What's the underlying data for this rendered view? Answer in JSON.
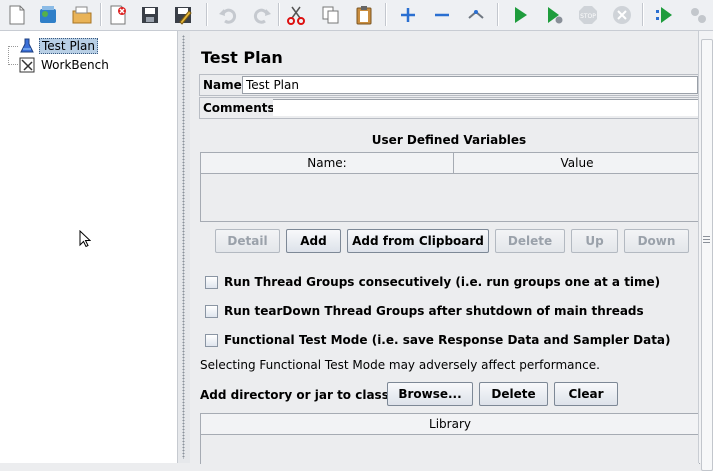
{
  "toolbar": {
    "buttons": [
      {
        "name": "new-icon",
        "enabled": true
      },
      {
        "name": "templates-icon",
        "enabled": true
      },
      {
        "name": "open-icon",
        "enabled": true
      },
      {
        "name": "close-icon",
        "enabled": true
      },
      {
        "name": "save-icon",
        "enabled": true
      },
      {
        "name": "save-as-icon",
        "enabled": true
      },
      {
        "name": "undo-icon",
        "enabled": false
      },
      {
        "name": "redo-icon",
        "enabled": false
      },
      {
        "name": "cut-icon",
        "enabled": true
      },
      {
        "name": "copy-icon",
        "enabled": true
      },
      {
        "name": "paste-icon",
        "enabled": true
      },
      {
        "name": "expand-icon",
        "enabled": true
      },
      {
        "name": "collapse-icon",
        "enabled": true
      },
      {
        "name": "toggle-icon",
        "enabled": true
      },
      {
        "name": "start-icon",
        "enabled": true
      },
      {
        "name": "start-no-pauses-icon",
        "enabled": true
      },
      {
        "name": "stop-icon",
        "enabled": false
      },
      {
        "name": "shutdown-icon",
        "enabled": false
      },
      {
        "name": "remote-start-icon",
        "enabled": true
      },
      {
        "name": "remote-stop-icon",
        "enabled": false
      }
    ],
    "stop_label": "STOP"
  },
  "tree": {
    "items": [
      {
        "label": "Test Plan",
        "icon": "test-plan-icon",
        "selected": true
      },
      {
        "label": "WorkBench",
        "icon": "workbench-icon",
        "selected": false
      }
    ]
  },
  "panel": {
    "title": "Test Plan",
    "name_label": "Name:",
    "name_value": "Test Plan",
    "comments_label": "Comments:",
    "comments_value": "",
    "variables_title": "User Defined Variables",
    "columns": [
      "Name:",
      "Value"
    ],
    "buttons": {
      "detail": "Detail",
      "add": "Add",
      "add_clipboard": "Add from Clipboard",
      "delete": "Delete",
      "up": "Up",
      "down": "Down"
    },
    "options": [
      {
        "label": "Run Thread Groups consecutively (i.e. run groups one at a time)",
        "checked": false
      },
      {
        "label": "Run tearDown Thread Groups after shutdown of main threads",
        "checked": false
      },
      {
        "label": "Functional Test Mode (i.e. save Response Data and Sampler Data)",
        "checked": false
      }
    ],
    "functional_note": "Selecting Functional Test Mode may adversely affect performance.",
    "classpath_label": "Add directory or jar to classpath",
    "classpath_buttons": {
      "browse": "Browse...",
      "delete": "Delete",
      "clear": "Clear"
    },
    "library_header": "Library"
  },
  "colors": {
    "accent": "#1e9c3c",
    "toolbar_bg": "#eef0f3",
    "selection": "#b8cfe5"
  }
}
